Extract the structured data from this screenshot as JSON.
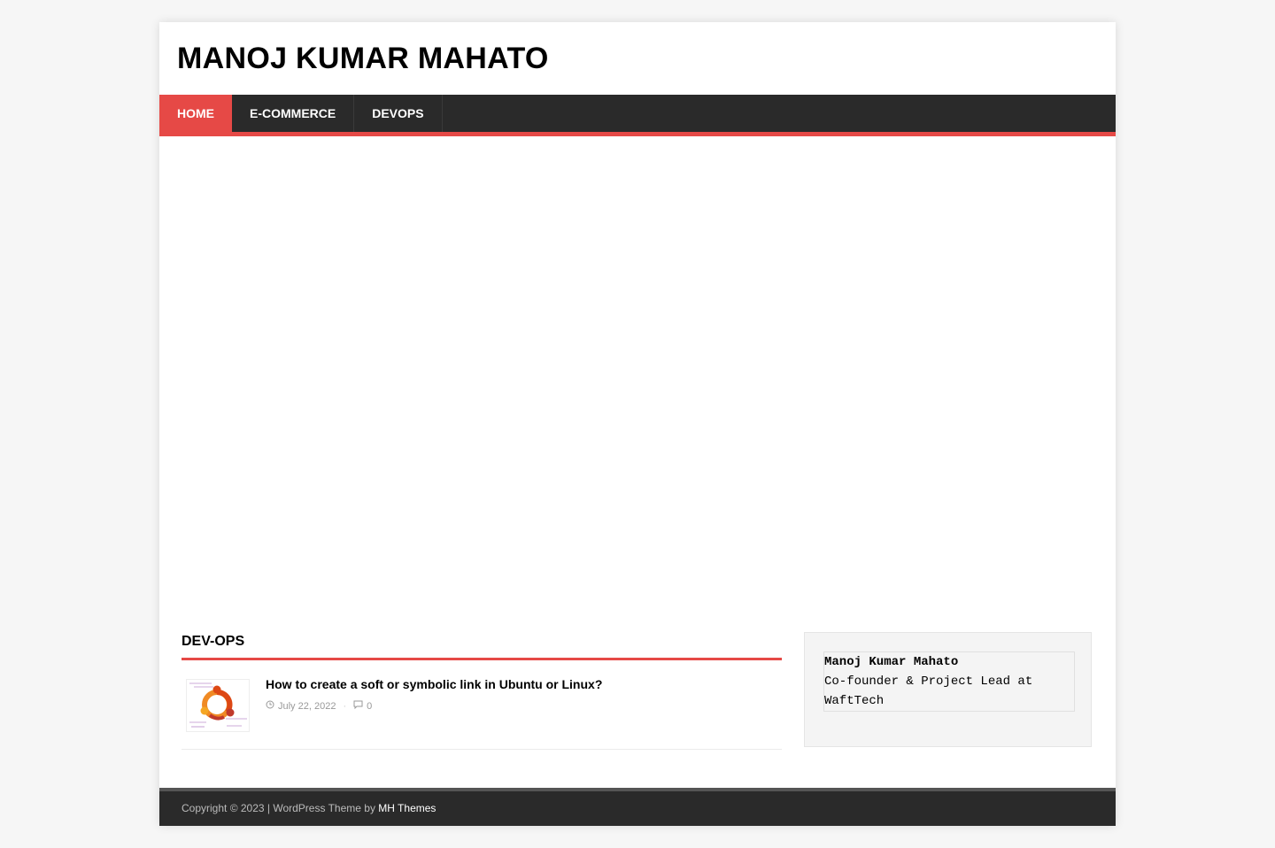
{
  "site": {
    "title": "MANOJ KUMAR MAHATO"
  },
  "nav": {
    "items": [
      {
        "label": "HOME"
      },
      {
        "label": "E-COMMERCE"
      },
      {
        "label": "DEVOPS"
      }
    ]
  },
  "section": {
    "title": "DEV-OPS"
  },
  "posts": [
    {
      "title": "How to create a soft or symbolic link in Ubuntu or Linux?",
      "date": "July 22, 2022",
      "comments": "0",
      "date_icon": "clock-icon",
      "comments_icon": "comment-icon"
    }
  ],
  "sidebar": {
    "name": "Manoj Kumar Mahato",
    "role": "Co-founder & Project Lead at WaftTech"
  },
  "footer": {
    "text": "Copyright © 2023 | WordPress Theme by ",
    "link": "MH Themes"
  },
  "colors": {
    "accent": "#e64946",
    "nav_bg": "#2a2a2a",
    "page_bg": "#f6f6f6"
  }
}
